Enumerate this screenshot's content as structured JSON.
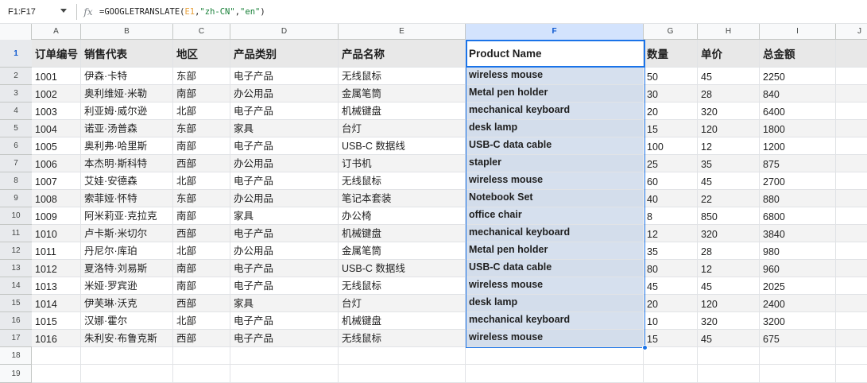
{
  "name_box": "F1:F17",
  "formula": {
    "prefix": "=GOOGLETRANSLATE(",
    "ref": "E1",
    "comma1": ",",
    "lang_from": "\"zh-CN\"",
    "comma2": ",",
    "lang_to": "\"en\"",
    "suffix": ")"
  },
  "columns": [
    "A",
    "B",
    "C",
    "D",
    "E",
    "F",
    "G",
    "H",
    "I",
    "J"
  ],
  "selected_column": "F",
  "row_numbers": [
    "1",
    "2",
    "3",
    "4",
    "5",
    "6",
    "7",
    "8",
    "9",
    "10",
    "11",
    "12",
    "13",
    "14",
    "15",
    "16",
    "17",
    "18",
    "19"
  ],
  "header": [
    "订单编号",
    "销售代表",
    "地区",
    "产品类别",
    "产品名称",
    "Product Name",
    "数量",
    "单价",
    "总金额"
  ],
  "rows": [
    [
      "1001",
      "伊森·卡特",
      "东部",
      "电子产品",
      "无线鼠标",
      "wireless mouse",
      "50",
      "45",
      "2250"
    ],
    [
      "1002",
      "奥利维娅·米勒",
      "南部",
      "办公用品",
      "金属笔筒",
      "Metal pen holder",
      "30",
      "28",
      "840"
    ],
    [
      "1003",
      "利亚姆·威尔逊",
      "北部",
      "电子产品",
      "机械键盘",
      "mechanical keyboard",
      "20",
      "320",
      "6400"
    ],
    [
      "1004",
      "诺亚·汤普森",
      "东部",
      "家具",
      "台灯",
      "desk lamp",
      "15",
      "120",
      "1800"
    ],
    [
      "1005",
      "奥利弗·哈里斯",
      "南部",
      "电子产品",
      "USB-C 数据线",
      "USB-C data cable",
      "100",
      "12",
      "1200"
    ],
    [
      "1006",
      "本杰明·斯科特",
      "西部",
      "办公用品",
      "订书机",
      "stapler",
      "25",
      "35",
      "875"
    ],
    [
      "1007",
      "艾娃·安德森",
      "北部",
      "电子产品",
      "无线鼠标",
      "wireless mouse",
      "60",
      "45",
      "2700"
    ],
    [
      "1008",
      "索菲娅·怀特",
      "东部",
      "办公用品",
      "笔记本套装",
      "Notebook Set",
      "40",
      "22",
      "880"
    ],
    [
      "1009",
      "阿米莉亚·克拉克",
      "南部",
      "家具",
      "办公椅",
      "office chair",
      "8",
      "850",
      "6800"
    ],
    [
      "1010",
      "卢卡斯·米切尔",
      "西部",
      "电子产品",
      "机械键盘",
      "mechanical keyboard",
      "12",
      "320",
      "3840"
    ],
    [
      "1011",
      "丹尼尔·库珀",
      "北部",
      "办公用品",
      "金属笔筒",
      "Metal pen holder",
      "35",
      "28",
      "980"
    ],
    [
      "1012",
      "夏洛特·刘易斯",
      "南部",
      "电子产品",
      "USB-C 数据线",
      "USB-C data cable",
      "80",
      "12",
      "960"
    ],
    [
      "1013",
      "米娅·罗宾逊",
      "南部",
      "电子产品",
      "无线鼠标",
      "wireless mouse",
      "45",
      "45",
      "2025"
    ],
    [
      "1014",
      "伊芙琳·沃克",
      "西部",
      "家具",
      "台灯",
      "desk lamp",
      "20",
      "120",
      "2400"
    ],
    [
      "1015",
      "汉娜·霍尔",
      "北部",
      "电子产品",
      "机械键盘",
      "mechanical keyboard",
      "10",
      "320",
      "3200"
    ],
    [
      "1016",
      "朱利安·布鲁克斯",
      "西部",
      "电子产品",
      "无线鼠标",
      "wireless mouse",
      "15",
      "45",
      "675"
    ]
  ],
  "colors": {
    "selection_border": "#1a73e8",
    "selection_fill": "#c8d5e8",
    "header_row_fill": "#e8e8e8",
    "stripe_fill": "#f3f3f3"
  }
}
